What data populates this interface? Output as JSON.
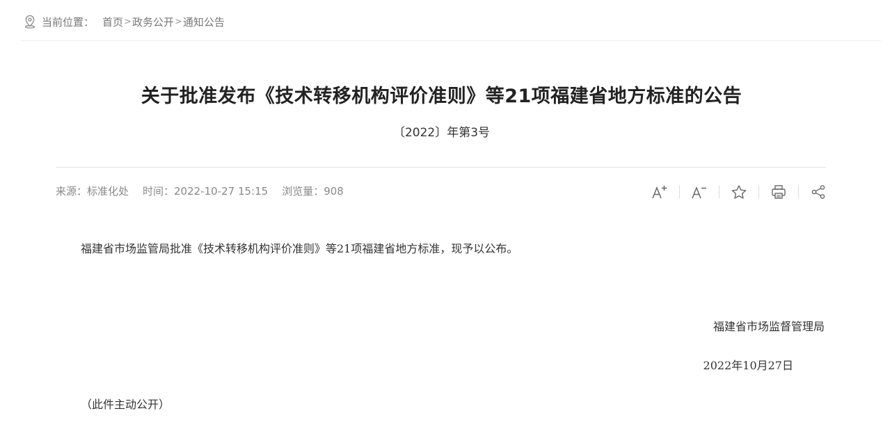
{
  "breadcrumb": {
    "icon": "location-pin-icon",
    "prefix": "当前位置：",
    "items": [
      "首页",
      "政务公开",
      "通知公告"
    ],
    "separator": ">"
  },
  "article": {
    "title": "关于批准发布《技术转移机构评价准则》等21项福建省地方标准的公告",
    "doc_number": "〔2022〕年第3号",
    "meta": {
      "source": "来源：标准化处",
      "time": "时间：2022-10-27 15:15",
      "views": "浏览量：908"
    },
    "tools": [
      {
        "name": "font-increase-icon"
      },
      {
        "name": "font-decrease-icon"
      },
      {
        "name": "star-icon"
      },
      {
        "name": "print-icon"
      },
      {
        "name": "share-icon"
      }
    ],
    "body": "福建省市场监管局批准《技术转移机构评价准则》等21项福建省地方标准，现予以公布。",
    "signature_org": "福建省市场监督管理局",
    "signature_date": "2022年10月27日",
    "footnote": "（此件主动公开）"
  },
  "colors": {
    "text": "#333333",
    "muted": "#888888",
    "divider": "#e3e3e3"
  }
}
